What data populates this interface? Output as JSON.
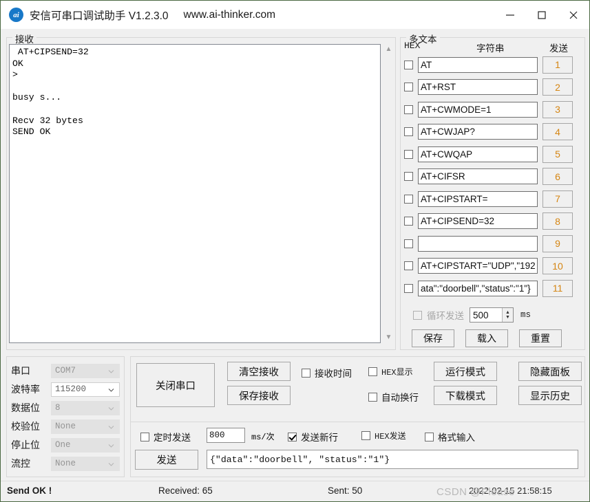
{
  "window": {
    "title": "安信可串口调试助手 V1.2.3.0",
    "url": "www.ai-thinker.com",
    "icon_label": "ai",
    "minimize": "minimize-icon",
    "maximize": "maximize-icon",
    "close": "close-icon"
  },
  "receive": {
    "group_label": "接收",
    "text": " AT+CIPSEND=32\nOK\n>\n\nbusy s...\n\nRecv 32 bytes\nSEND OK\n"
  },
  "multitext": {
    "group_label": "多文本",
    "col_hex": "HEX",
    "col_string": "字符串",
    "col_send": "发送",
    "rows": [
      {
        "hex_checked": false,
        "value": "AT",
        "send_label": "1"
      },
      {
        "hex_checked": false,
        "value": "AT+RST",
        "send_label": "2"
      },
      {
        "hex_checked": false,
        "value": "AT+CWMODE=1",
        "send_label": "3"
      },
      {
        "hex_checked": false,
        "value": "AT+CWJAP?",
        "send_label": "4"
      },
      {
        "hex_checked": false,
        "value": "AT+CWQAP",
        "send_label": "5"
      },
      {
        "hex_checked": false,
        "value": "AT+CIFSR",
        "send_label": "6"
      },
      {
        "hex_checked": false,
        "value": "AT+CIPSTART=",
        "send_label": "7"
      },
      {
        "hex_checked": false,
        "value": " AT+CIPSEND=32",
        "send_label": "8"
      },
      {
        "hex_checked": false,
        "value": "",
        "send_label": "9"
      },
      {
        "hex_checked": false,
        "value": "AT+CIPSTART=\"UDP\",\"192",
        "send_label": "10"
      },
      {
        "hex_checked": false,
        "value": "ata\":\"doorbell\",\"status\":\"1\"}",
        "send_label": "11"
      }
    ],
    "loop_send_label": "循环发送",
    "loop_send_checked": false,
    "loop_interval": "500",
    "loop_unit": "ms",
    "save_label": "保存",
    "load_label": "载入",
    "reset_label": "重置"
  },
  "serial": {
    "rows": [
      {
        "label": "串口",
        "value": "COM7",
        "active": false
      },
      {
        "label": "波特率",
        "value": "115200",
        "active": true
      },
      {
        "label": "数据位",
        "value": "8",
        "active": false
      },
      {
        "label": "校验位",
        "value": "None",
        "active": false
      },
      {
        "label": "停止位",
        "value": "One",
        "active": false
      },
      {
        "label": "流控",
        "value": "None",
        "active": false
      }
    ]
  },
  "controls": {
    "close_port_label": "关闭串口",
    "clear_recv_label": "清空接收",
    "save_recv_label": "保存接收",
    "recv_time_label": "接收时间",
    "recv_time_checked": false,
    "hex_display_label": "HEX显示",
    "hex_display_checked": false,
    "auto_wrap_label": "自动换行",
    "auto_wrap_checked": false,
    "run_mode_label": "运行模式",
    "download_mode_label": "下载模式",
    "hide_panel_label": "隐藏面板",
    "show_history_label": "显示历史"
  },
  "send": {
    "timed_send_label": "定时发送",
    "timed_send_checked": false,
    "interval_value": "800",
    "interval_unit": "ms/次",
    "newline_label": "发送新行",
    "newline_checked": true,
    "hex_send_label": "HEX发送",
    "hex_send_checked": false,
    "format_input_label": "格式输入",
    "format_input_checked": false,
    "send_button_label": "发送",
    "send_text": "{\"data\":\"doorbell\", \"status\":\"1\"}"
  },
  "status": {
    "send_state": "Send OK !",
    "received": "Received: 65",
    "sent": "Sent: 50",
    "timestamp": "2022-02-15 21:58:15",
    "watermark": "CSDN @Please"
  },
  "colors": {
    "accent": "#1878c8",
    "send_number": "#d58512",
    "window_bg": "#f0f0f0"
  }
}
